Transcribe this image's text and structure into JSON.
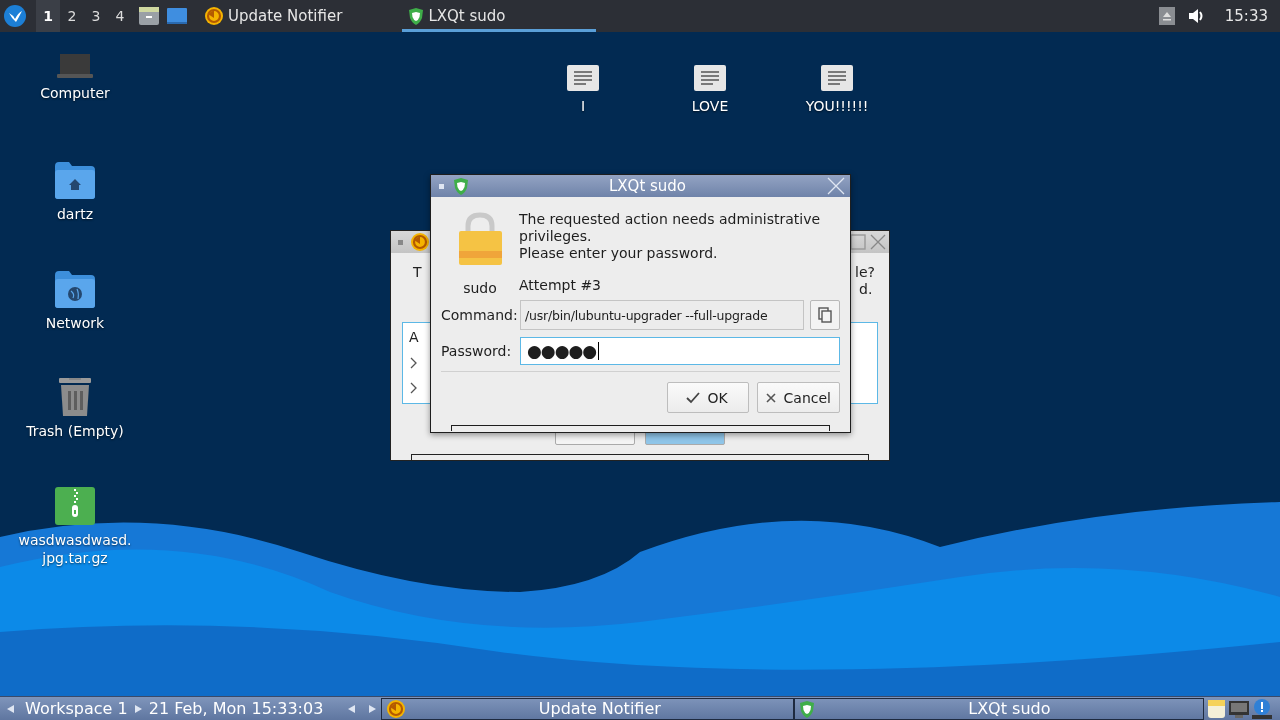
{
  "top_panel": {
    "workspaces": [
      {
        "label": "1",
        "selected": true
      },
      {
        "label": "2",
        "selected": false
      },
      {
        "label": "3",
        "selected": false
      },
      {
        "label": "4",
        "selected": false
      }
    ],
    "tasks": [
      {
        "label": "Update Notifier",
        "kind": "update",
        "selected": false
      },
      {
        "label": "LXQt sudo",
        "kind": "shield",
        "selected": true
      }
    ],
    "clock": "15:33"
  },
  "desktop_icons": [
    {
      "label": "Computer",
      "kind": "computer"
    },
    {
      "label": "dartz",
      "kind": "home-folder"
    },
    {
      "label": "Network",
      "kind": "network-folder"
    },
    {
      "label": "Trash (Empty)",
      "kind": "trash"
    },
    {
      "label": "wasdwasdwasd.jpg.tar.gz",
      "kind": "archive"
    },
    {
      "label": "I",
      "kind": "text-file"
    },
    {
      "label": "LOVE",
      "kind": "text-file"
    },
    {
      "label": "YOU!!!!!!",
      "kind": "text-file"
    }
  ],
  "background_window": {
    "texts": [
      "T",
      "le?",
      "d.",
      "A"
    ]
  },
  "dialog": {
    "title": "LXQt sudo",
    "icon_label": "sudo",
    "message": "The requested action needs administrative privileges.\nPlease enter your password.",
    "attempt": "Attempt #3",
    "command_label": "Command:",
    "command": "/usr/bin/lubuntu-upgrader --full-upgrade",
    "password_label": "Password:",
    "password": "●●●●●",
    "buttons": [
      {
        "label": "OK",
        "kind": "ok"
      },
      {
        "label": "Cancel",
        "kind": "cancel"
      }
    ]
  },
  "bottom_panel": {
    "workspace": "Workspace 1",
    "datetime": "21 Feb, Mon 15:33:03",
    "tasks": [
      {
        "label": "Update Notifier",
        "kind": "update",
        "selected": false
      },
      {
        "label": "LXQt sudo",
        "kind": "shield",
        "selected": false
      }
    ]
  }
}
